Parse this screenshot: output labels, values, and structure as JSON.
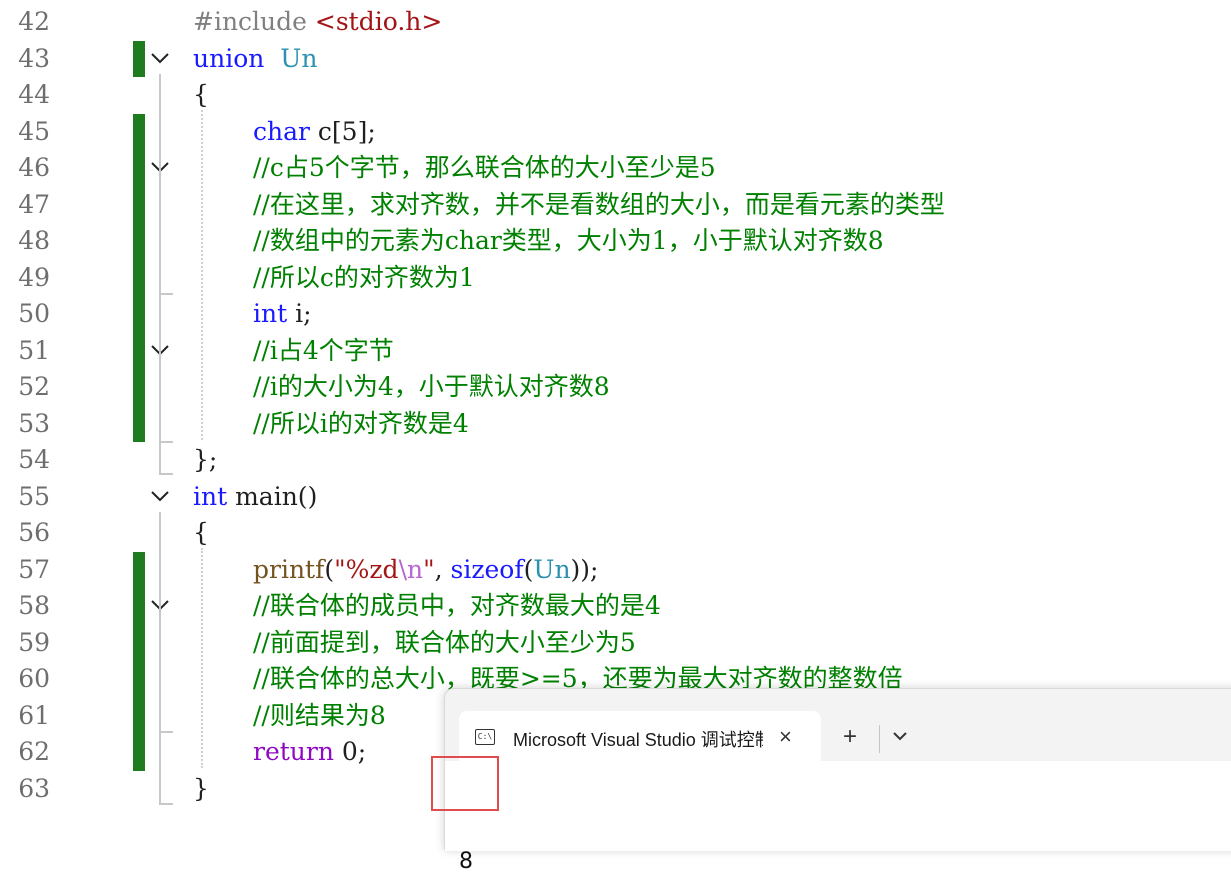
{
  "editor": {
    "lines": [
      {
        "num": "42",
        "tokens": [
          [
            "pp",
            "#include "
          ],
          [
            "st",
            "<stdio.h>"
          ]
        ]
      },
      {
        "num": "43",
        "tokens": [
          [
            "kw",
            "union"
          ],
          [
            "",
            "  "
          ],
          [
            "ty",
            "Un"
          ]
        ]
      },
      {
        "num": "44",
        "tokens": [
          [
            "",
            "{"
          ]
        ]
      },
      {
        "num": "45",
        "tokens": [
          [
            "kw",
            "char"
          ],
          [
            "",
            " c[5];"
          ]
        ]
      },
      {
        "num": "46",
        "tokens": [
          [
            "cm",
            "//c占5个字节，那么联合体的大小至少是5"
          ]
        ]
      },
      {
        "num": "47",
        "tokens": [
          [
            "cm",
            "//在这里，求对齐数，并不是看数组的大小，而是看元素的类型"
          ]
        ]
      },
      {
        "num": "48",
        "tokens": [
          [
            "cm",
            "//数组中的元素为char类型，大小为1，小于默认对齐数8"
          ]
        ]
      },
      {
        "num": "49",
        "tokens": [
          [
            "cm",
            "//所以c的对齐数为1"
          ]
        ]
      },
      {
        "num": "50",
        "tokens": [
          [
            "kw",
            "int"
          ],
          [
            "",
            " i;"
          ]
        ]
      },
      {
        "num": "51",
        "tokens": [
          [
            "cm",
            "//i占4个字节"
          ]
        ]
      },
      {
        "num": "52",
        "tokens": [
          [
            "cm",
            "//i的大小为4，小于默认对齐数8"
          ]
        ]
      },
      {
        "num": "53",
        "tokens": [
          [
            "cm",
            "//所以i的对齐数是4"
          ]
        ]
      },
      {
        "num": "54",
        "tokens": [
          [
            "",
            "};"
          ]
        ]
      },
      {
        "num": "55",
        "tokens": [
          [
            "kw",
            "int"
          ],
          [
            "",
            " main()"
          ]
        ]
      },
      {
        "num": "56",
        "tokens": [
          [
            "",
            "{"
          ]
        ]
      },
      {
        "num": "57",
        "tokens": [
          [
            "fn",
            "printf"
          ],
          [
            "",
            "("
          ],
          [
            "st",
            "\"%zd"
          ],
          [
            "esc",
            "\\n"
          ],
          [
            "st",
            "\""
          ],
          [
            "",
            ", "
          ],
          [
            "kw",
            "sizeof"
          ],
          [
            "",
            "("
          ],
          [
            "ty",
            "Un"
          ],
          [
            "",
            "));"
          ]
        ]
      },
      {
        "num": "58",
        "tokens": [
          [
            "cm",
            "//联合体的成员中，对齐数最大的是4"
          ]
        ]
      },
      {
        "num": "59",
        "tokens": [
          [
            "cm",
            "//前面提到，联合体的大小至少为5"
          ]
        ]
      },
      {
        "num": "60",
        "tokens": [
          [
            "cm",
            "//联合体的总大小，既要>=5，还要为最大对齐数的整数倍"
          ]
        ]
      },
      {
        "num": "61",
        "tokens": [
          [
            "cm",
            "//则结果为8"
          ]
        ]
      },
      {
        "num": "62",
        "tokens": [
          [
            "ctl",
            "return"
          ],
          [
            "",
            " 0;"
          ]
        ]
      },
      {
        "num": "63",
        "tokens": [
          [
            "",
            "}"
          ]
        ]
      }
    ]
  },
  "console": {
    "tab_title": "Microsoft Visual Studio 调试控制台",
    "tab_icon_text": "C:\\",
    "new_tab_label": "+",
    "close_label": "×",
    "output": "8"
  },
  "colors": {
    "keyword": "#1a1aff",
    "type": "#2b91af",
    "comment": "#008000",
    "string": "#a31515",
    "change_bar": "#1e7b1e",
    "highlight_box": "#e04b4b"
  }
}
